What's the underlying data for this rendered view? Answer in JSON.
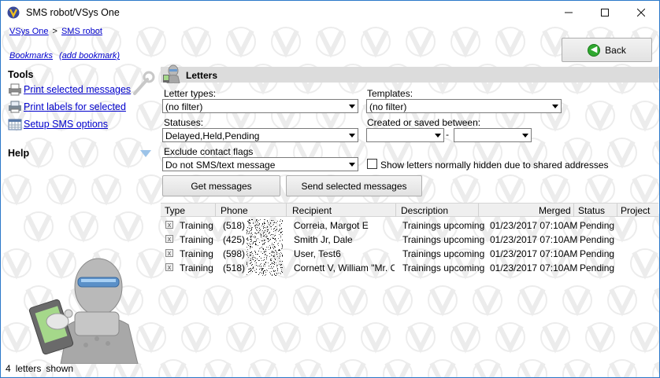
{
  "window": {
    "title": "SMS robot/VSys One",
    "minimize": "—",
    "maximize": "□",
    "close": "✕"
  },
  "breadcrumb": {
    "home": "VSys One",
    "separator": ">",
    "current": "SMS robot"
  },
  "bookmarks": {
    "label": "Bookmarks",
    "add": "(add bookmark)"
  },
  "back_button": {
    "label": "Back"
  },
  "left_panel": {
    "tools_heading": "Tools",
    "tools": [
      {
        "label": "Print selected messages",
        "icon": "printer-icon"
      },
      {
        "label": "Print labels for selected",
        "icon": "label-printer-icon"
      },
      {
        "label": "Setup SMS options",
        "icon": "calendar-settings-icon"
      }
    ],
    "help_heading": "Help"
  },
  "letters": {
    "title": "Letters",
    "letter_types_label": "Letter types:",
    "letter_types_value": "(no filter)",
    "templates_label": "Templates:",
    "templates_value": "(no filter)",
    "statuses_label": "Statuses:",
    "statuses_value": "Delayed,Held,Pending",
    "created_label": "Created or saved between:",
    "created_from": "",
    "created_dash": "-",
    "created_to": "",
    "exclude_label": "Exclude contact flags",
    "exclude_value": "Do not SMS/text message",
    "hidden_checkbox_label": "Show letters normally hidden due to shared addresses",
    "get_messages": "Get messages",
    "send_selected": "Send selected messages"
  },
  "grid": {
    "columns": [
      "Type",
      "Phone",
      "Recipient",
      "Description",
      "Merged",
      "Status",
      "Project"
    ],
    "rows": [
      {
        "type": "Training",
        "phone": "(518)",
        "recipient": "Correia, Margot E",
        "description": "Trainings upcoming",
        "merged": "01/23/2017 07:10AM",
        "status": "Pending",
        "project": ""
      },
      {
        "type": "Training",
        "phone": "(425)",
        "recipient": "Smith Jr, Dale",
        "description": "Trainings upcoming",
        "merged": "01/23/2017 07:10AM",
        "status": "Pending",
        "project": ""
      },
      {
        "type": "Training",
        "phone": "(598)",
        "recipient": "User, Test6",
        "description": "Trainings upcoming",
        "merged": "01/23/2017 07:10AM",
        "status": "Pending",
        "project": ""
      },
      {
        "type": "Training",
        "phone": "(518)",
        "recipient": "Cornett V, William \"Mr. C\"",
        "description": "Trainings upcoming",
        "merged": "01/23/2017 07:10AM",
        "status": "Pending",
        "project": ""
      }
    ]
  },
  "status_bar": {
    "count": "4",
    "word1": "letters",
    "word2": "shown"
  }
}
